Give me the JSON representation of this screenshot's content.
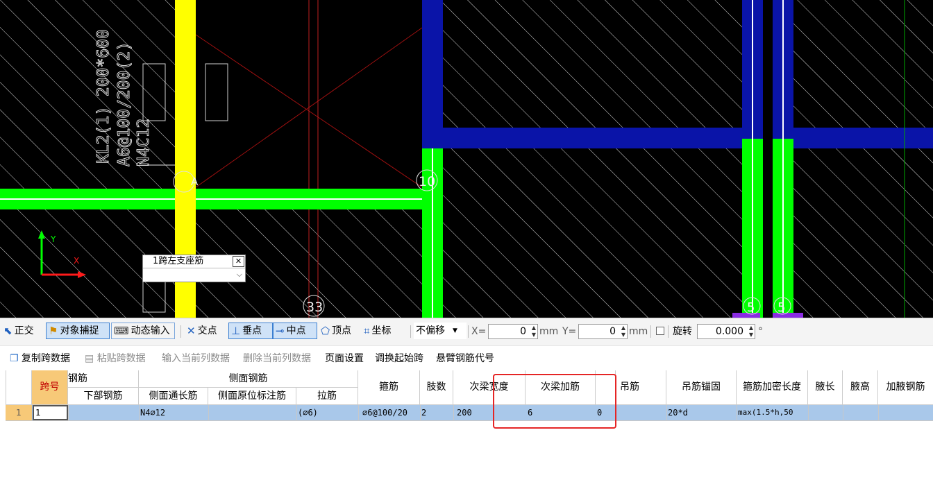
{
  "canvas": {
    "beam_text": "KL2(1) 200*600",
    "stirrup_text": "A6@100/200(2)",
    "side_text": "N4C12",
    "labels": {
      "a": "A",
      "ten": "10",
      "thirtythree": "33",
      "five_a": "5",
      "five_b": "5"
    },
    "axis_y": "Y",
    "axis_x": "X",
    "popup": {
      "title": "1跨左支座筋",
      "close_icon": "close-icon",
      "value": ""
    }
  },
  "toolbar1": {
    "ortho": "正交",
    "snap": "对象捕捉",
    "dynamic_input": "动态输入",
    "intersection": "交点",
    "perpendicular": "垂点",
    "midpoint": "中点",
    "vertex": "顶点",
    "coordinate": "坐标",
    "offset_mode": "不偏移",
    "x_label": "X=",
    "x_value": "0",
    "mm1": "mm",
    "y_label": "Y=",
    "y_value": "0",
    "mm2": "mm",
    "rotate_label": "旋转",
    "rotate_value": "0.000",
    "degree": "°"
  },
  "toolbar2": {
    "copy_span": "复制跨数据",
    "paste_span": "粘贴跨数据",
    "input_column": "输入当前列数据",
    "delete_column": "删除当前列数据",
    "page_setup": "页面设置",
    "swap_start": "调换起始跨",
    "cantilever": "悬臂钢筋代号"
  },
  "grid": {
    "headers": {
      "span_no": "跨号",
      "rebar_group": "钢筋",
      "bottom_rebar": "下部钢筋",
      "side_group": "侧面钢筋",
      "side_through": "侧面通长筋",
      "side_original": "侧面原位标注筋",
      "tie_bar": "拉筋",
      "stirrup": "箍筋",
      "legs": "肢数",
      "sec_beam_width": "次梁宽度",
      "sec_beam_add": "次梁加筋",
      "hanger": "吊筋",
      "hanger_anchor": "吊筋锚固",
      "dense_length": "箍筋加密长度",
      "haunch_length": "腋长",
      "haunch_height": "腋高",
      "haunch_rebar": "加腋钢筋"
    },
    "rows": [
      {
        "row_num": "1",
        "span_no": "1",
        "bottom_rebar": "",
        "side_through": "N4⌀12",
        "side_original": "",
        "tie_bar": "(⌀6)",
        "stirrup": "⌀6@100/20",
        "legs": "2",
        "sec_beam_width": "200",
        "sec_beam_add": "6",
        "extra_zero": "0",
        "hanger": "",
        "hanger_anchor": "20*d",
        "dense_length": "max(1.5*h,50",
        "haunch_length": "",
        "haunch_height": "",
        "haunch_rebar": ""
      }
    ]
  },
  "colors": {
    "canvas_bg": "#000000",
    "hatch": "#d8d8d8",
    "wall_green": "#00ff00",
    "beam_yellow": "#ffff00",
    "beam_blue": "#0a14a8",
    "selected_row": "#a9c8ea",
    "highlight_box": "#e52525"
  }
}
